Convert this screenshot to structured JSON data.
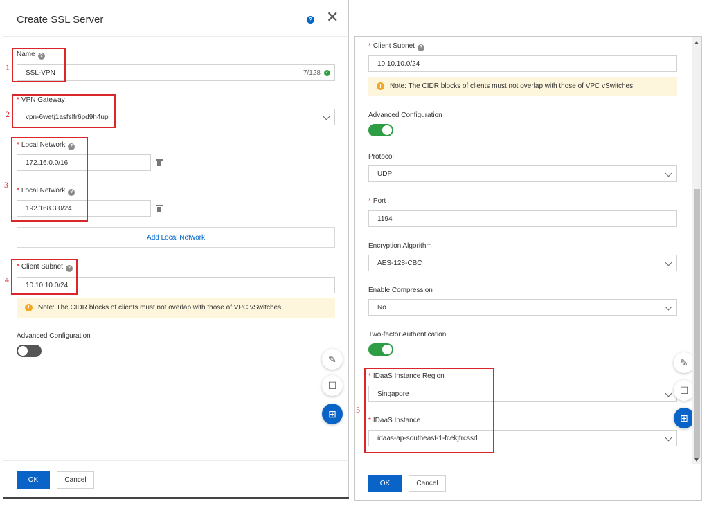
{
  "left": {
    "title": "Create SSL Server",
    "name": {
      "label": "Name",
      "value": "SSL-VPN",
      "count": "7/128"
    },
    "vpn_gateway": {
      "label": "VPN Gateway",
      "value": "vpn-6wetj1asfslfr6pd9h4up"
    },
    "local_networks": [
      {
        "label": "Local Network",
        "value": "172.16.0.0/16"
      },
      {
        "label": "Local Network",
        "value": "192.168.3.0/24"
      }
    ],
    "add_local_network": "Add Local Network",
    "client_subnet": {
      "label": "Client Subnet",
      "value": "10.10.10.0/24"
    },
    "note": "Note: The CIDR blocks of clients must not overlap with those of VPC vSwitches.",
    "advanced": {
      "label": "Advanced Configuration",
      "enabled": false
    },
    "ok": "OK",
    "cancel": "Cancel"
  },
  "right": {
    "client_subnet": {
      "label": "Client Subnet",
      "value": "10.10.10.0/24"
    },
    "note": "Note: The CIDR blocks of clients must not overlap with those of VPC vSwitches.",
    "advanced": {
      "label": "Advanced Configuration",
      "enabled": true
    },
    "protocol": {
      "label": "Protocol",
      "value": "UDP"
    },
    "port": {
      "label": "Port",
      "value": "1194"
    },
    "encryption": {
      "label": "Encryption Algorithm",
      "value": "AES-128-CBC"
    },
    "compression": {
      "label": "Enable Compression",
      "value": "No"
    },
    "two_factor": {
      "label": "Two-factor Authentication",
      "enabled": true
    },
    "idaas_region": {
      "label": "IDaaS Instance Region",
      "value": "Singapore"
    },
    "idaas_instance": {
      "label": "IDaaS Instance",
      "value": "idaas-ap-southeast-1-fcekjfrcssd"
    },
    "ok": "OK",
    "cancel": "Cancel"
  },
  "markers": [
    "1",
    "2",
    "3",
    "4",
    "5"
  ],
  "colors": {
    "primary": "#0a64c8",
    "annotation": "#d9262b",
    "toggle_on": "#2e9e45",
    "note_bg": "#fdf5dc"
  },
  "icons": [
    "help-icon",
    "close-icon",
    "check-icon",
    "trash-icon",
    "warning-icon",
    "feedback-icon",
    "chat-icon",
    "apps-icon",
    "chevron-down-icon"
  ]
}
